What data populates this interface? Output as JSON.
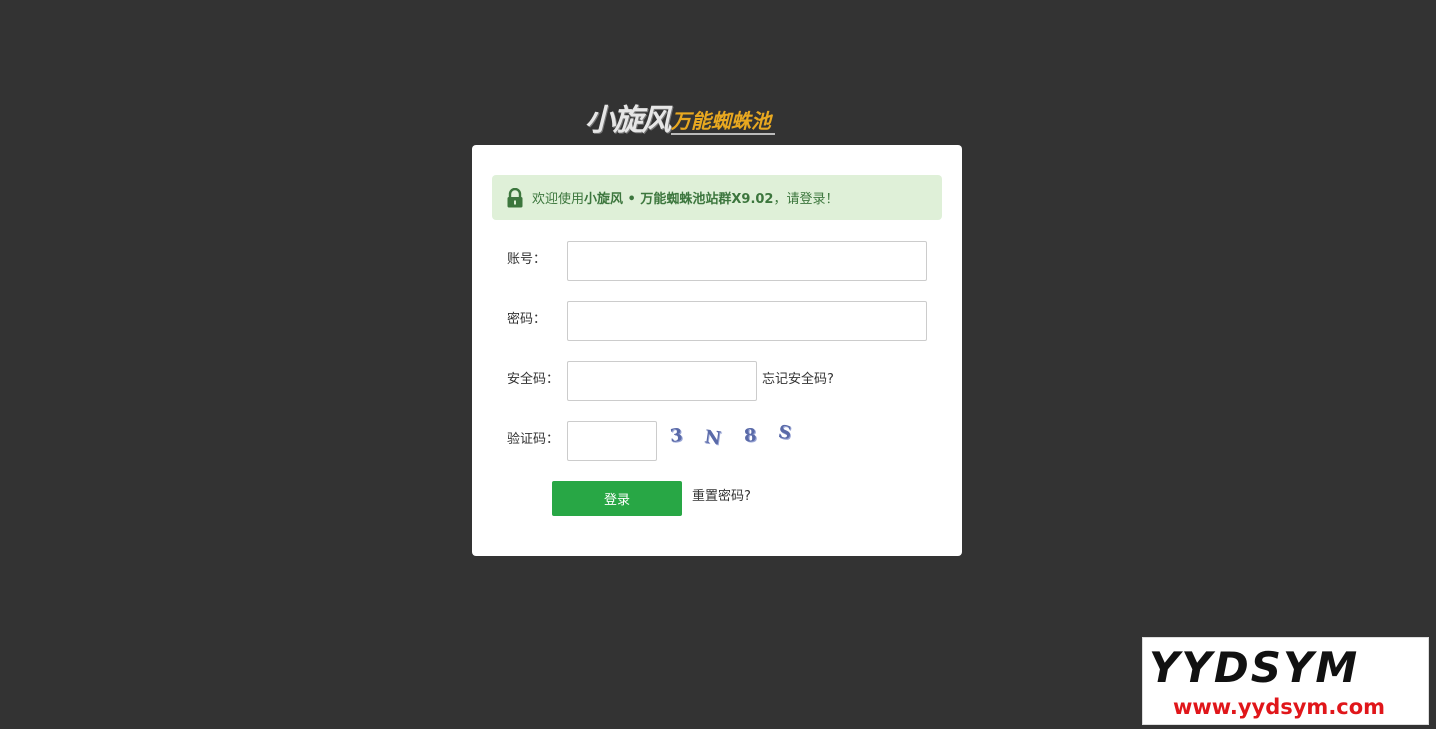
{
  "logo": {
    "main": "小旋风",
    "sub": "万能蜘蛛池"
  },
  "alert": {
    "prefix": "欢迎使用",
    "product": "小旋风 • 万能蜘蛛池站群X9.02",
    "suffix": "，请登录！",
    "icon": "lock-icon"
  },
  "form": {
    "account_label": "账号：",
    "account_value": "",
    "password_label": "密码：",
    "password_value": "",
    "security_label": "安全码：",
    "security_value": "",
    "forgot_security": "忘记安全码?",
    "captcha_label": "验证码：",
    "captcha_value": "",
    "captcha_chars": [
      "3",
      "N",
      "8",
      "S"
    ],
    "login_button": "登录",
    "reset_password": "重置密码?"
  },
  "watermark": {
    "brand": "YYDSYM",
    "url": "www.yydsym.com"
  },
  "colors": {
    "background": "#333333",
    "alert_bg": "#dff0d8",
    "alert_text": "#3c763d",
    "button": "#28a745",
    "logo_accent": "#e8a820",
    "watermark_url": "#e0161a"
  }
}
